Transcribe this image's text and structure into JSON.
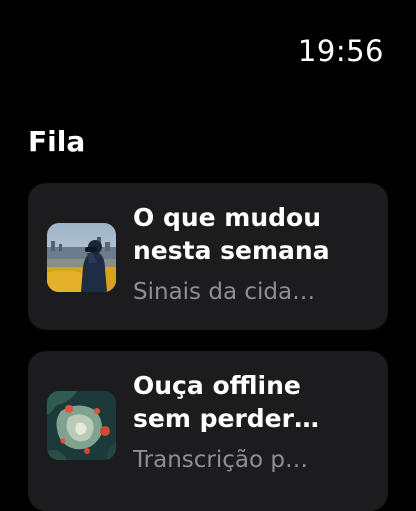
{
  "status": {
    "time": "19:56"
  },
  "section": {
    "title": "Fila"
  },
  "queue": [
    {
      "title_line1": "O que mudou",
      "title_line2": "nesta semana",
      "subtitle": "Sinais da cida…",
      "artwork": "city-observer-artwork"
    },
    {
      "title_line1": "Ouça offline",
      "title_line2": "sem perder…",
      "subtitle": "Transcrição p…",
      "artwork": "abstract-map-artwork"
    }
  ],
  "colors": {
    "background": "#000000",
    "card": "#1c1c1e",
    "title": "#ffffff",
    "subtitle": "#8e8e93"
  }
}
